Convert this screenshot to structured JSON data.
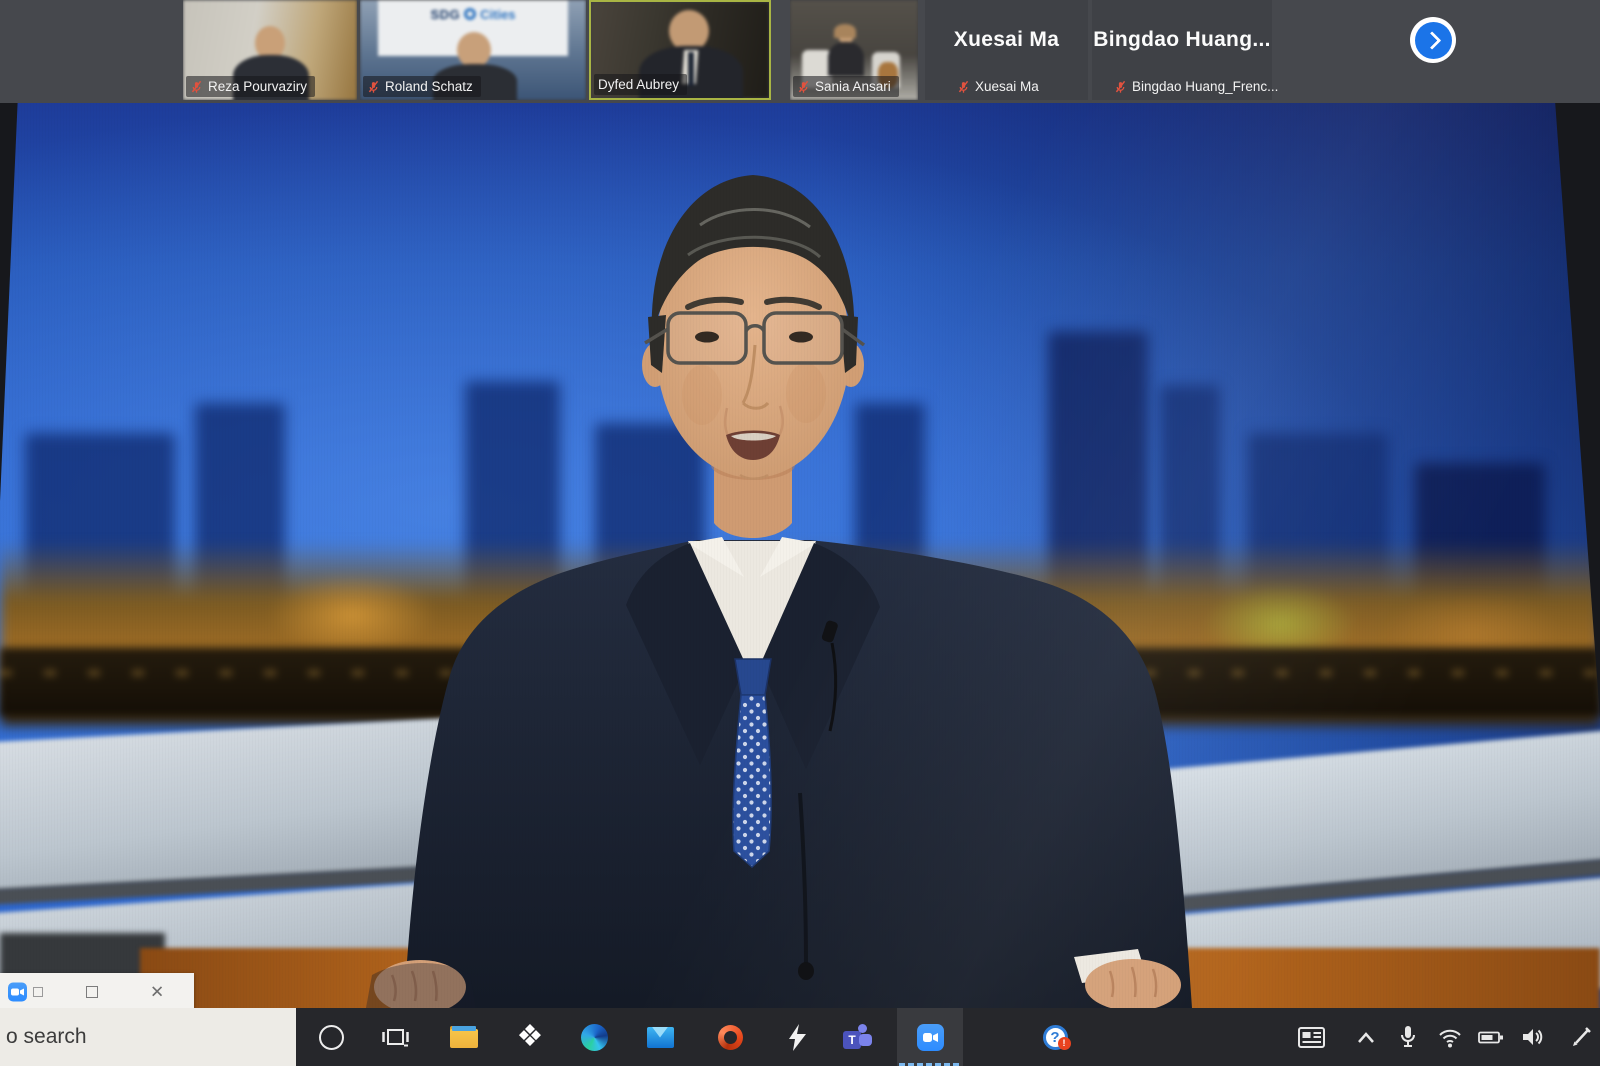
{
  "meeting": {
    "participants": [
      {
        "name": "Reza Pourvaziry",
        "muted": true,
        "has_video": true
      },
      {
        "name": "Roland Schatz",
        "muted": true,
        "has_video": true,
        "banner_sdg": "SDG",
        "banner_cities": "Cities"
      },
      {
        "name": "Dyfed Aubrey",
        "muted": false,
        "active_speaker": true,
        "has_video": true
      },
      {
        "name": "Sania Ansari",
        "muted": true,
        "has_video": true
      },
      {
        "name": "Xuesai Ma",
        "tile_label": "Xuesai Ma",
        "muted": true,
        "has_video": false
      },
      {
        "name": "Bingdao Huang_Frenc...",
        "tile_label": "Bingdao  Huang...",
        "muted": true,
        "has_video": false
      }
    ],
    "next_button_icon": "chevron-right-icon",
    "main_speaker": {
      "description": "speaker in navy suit with glasses and blue polka-dot tie in blue TV-studio with city skyline backdrop",
      "visible_text": ""
    }
  },
  "floating_window": {
    "icons": [
      "zoom-app-icon",
      "restore-icon",
      "maximize-icon",
      "close-icon"
    ]
  },
  "taskbar": {
    "search_text": "o search",
    "app_icons": [
      "cortana",
      "task-view",
      "file-explorer",
      "dropbox",
      "edge",
      "mail",
      "office",
      "lightning-app",
      "teams",
      "zoom",
      "help"
    ],
    "active_app": "zoom",
    "tray_icons": [
      "news-widget",
      "chevron-up",
      "microphone",
      "wifi",
      "battery",
      "volume",
      "pen"
    ]
  },
  "colors": {
    "zoom_blue": "#2D8CFF",
    "active_speaker_border": "#a9b544",
    "muted_mic_red": "#e0523f",
    "next_button_blue": "#1b74e8",
    "taskbar_bg": "#26272b",
    "studio_blue": "#2b63cc",
    "studio_amber": "#b2641c",
    "teams_purple": "#4b53bc",
    "office_orange": "#e8491d"
  }
}
